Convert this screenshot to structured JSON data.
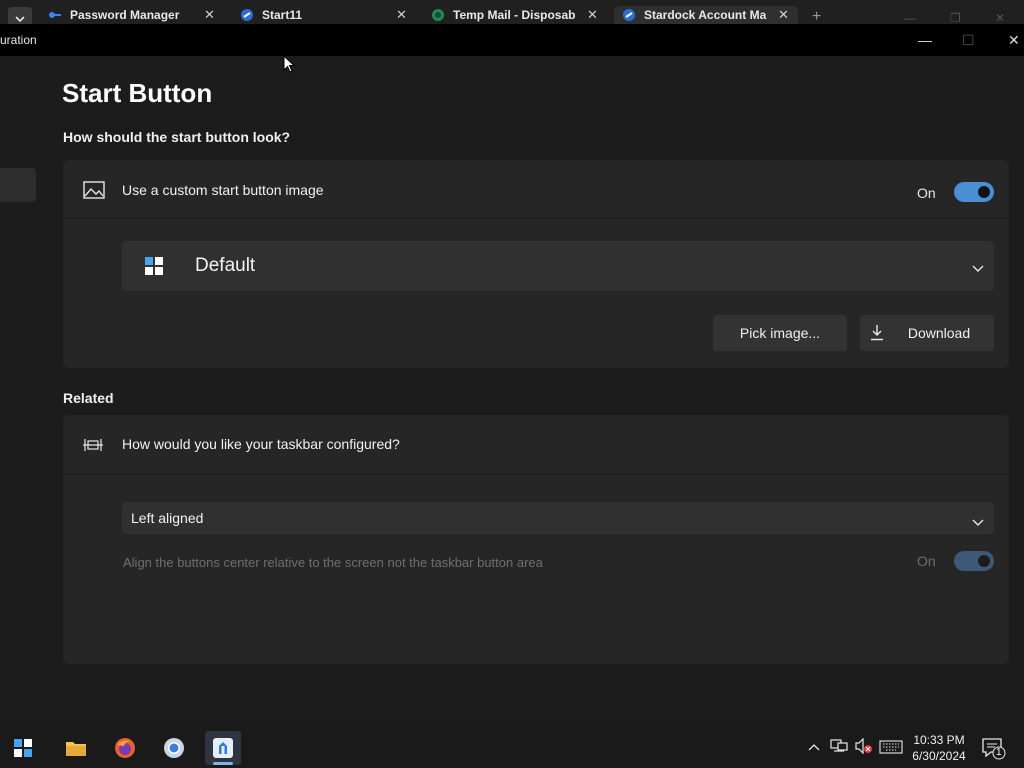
{
  "browser": {
    "tabs": [
      {
        "label": "Password Manager"
      },
      {
        "label": "Start11"
      },
      {
        "label": "Temp Mail - Disposab"
      },
      {
        "label": "Stardock Account Ma"
      }
    ],
    "new_tab_glyph": "+"
  },
  "window": {
    "title": "uration",
    "minimize_glyph": "—",
    "maximize_glyph": "☐",
    "close_glyph": "✕"
  },
  "page": {
    "title": "Start Button",
    "look_heading": "How should the start button look?",
    "custom_image_label": "Use a custom start button image",
    "custom_image_state": "On",
    "start_style_value": "Default",
    "pick_image_label": "Pick image...",
    "download_label": "Download",
    "related_heading": "Related",
    "taskbar_label": "How would you like your taskbar configured?",
    "taskbar_alignment_value": "Left aligned",
    "align_center_label": "Align the buttons center relative to the screen not the taskbar button area",
    "align_center_state": "On"
  },
  "taskbar": {
    "time": "10:33 PM",
    "date": "6/30/2024",
    "notification_count": "1"
  },
  "colors": {
    "accent": "#4a8fd4",
    "background": "#1c1c1c",
    "card": "#262626"
  }
}
